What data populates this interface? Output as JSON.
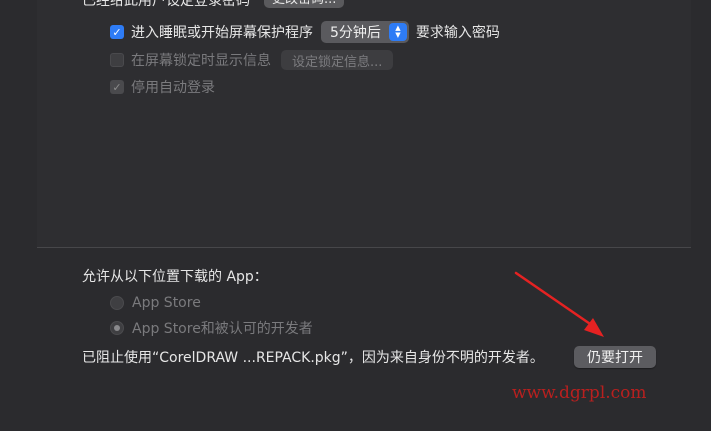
{
  "password_section": {
    "clipped_label": "已经给此用户设定登录密码",
    "change_password_button": "更改密码..."
  },
  "options": {
    "require_password": {
      "checked": true,
      "prefix": "进入睡眠或开始屏幕保护程序",
      "delay_value": "5分钟后",
      "suffix": "要求输入密码"
    },
    "show_message": {
      "checked": false,
      "enabled": false,
      "label": "在屏幕锁定时显示信息",
      "button": "设定锁定信息..."
    },
    "disable_auto_login": {
      "checked": true,
      "enabled": false,
      "label": "停用自动登录"
    }
  },
  "download_section": {
    "title": "允许从以下位置下载的 App：",
    "radios": [
      {
        "label": "App Store",
        "selected": false
      },
      {
        "label": "App Store和被认可的开发者",
        "selected": true
      }
    ],
    "blocked_message": "已阻止使用“CorelDRAW ...REPACK.pkg”，因为来自身份不明的开发者。",
    "open_anyway_button": "仍要打开"
  },
  "watermark": {
    "text": "www.dgrpl.com",
    "color": "#b8201f"
  },
  "annotation_arrow": {
    "color": "#e52222"
  },
  "theme": {
    "accent": "#2e7cf6",
    "background": "#2b2b2e"
  }
}
